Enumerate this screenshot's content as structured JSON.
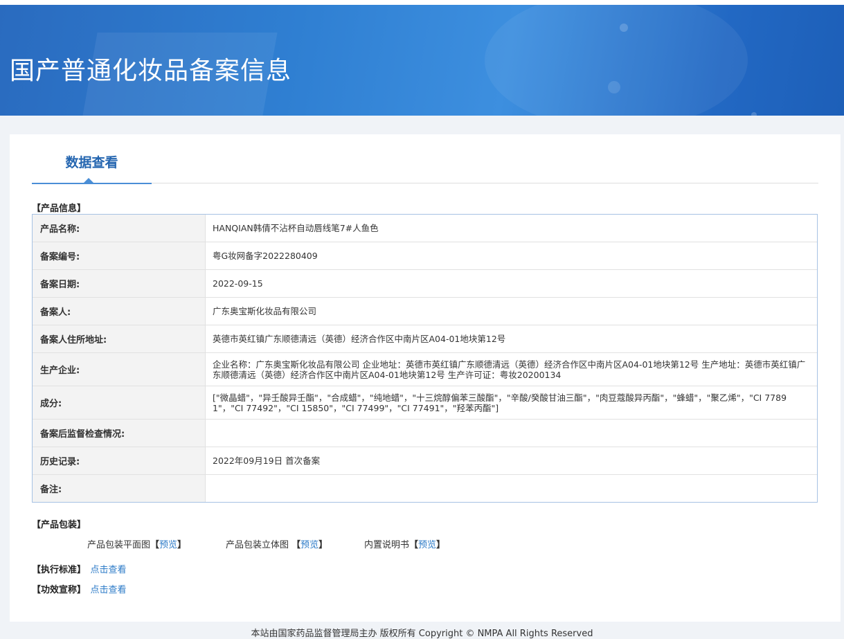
{
  "page": {
    "banner_title": "国产普通化妆品备案信息",
    "tab_label": "数据查看",
    "footer": "本站由国家药品监督管理局主办 版权所有 Copyright © NMPA All Rights Reserved"
  },
  "product_section": {
    "title": "【产品信息】",
    "rows": [
      {
        "label": "产品名称:",
        "value": "HANQIAN韩倩不沾杯自动唇线笔7#人鱼色"
      },
      {
        "label": "备案编号:",
        "value": "粤G妆网备字2022280409"
      },
      {
        "label": "备案日期:",
        "value": "2022-09-15"
      },
      {
        "label": "备案人:",
        "value": "广东奥宝斯化妆品有限公司"
      },
      {
        "label": "备案人住所地址:",
        "value": "英德市英红镇广东顺德清远（英德）经济合作区中南片区A04-01地块第12号"
      },
      {
        "label": "生产企业:",
        "value": "企业名称：广东奥宝斯化妆品有限公司 企业地址：英德市英红镇广东顺德清远（英德）经济合作区中南片区A04-01地块第12号 生产地址：英德市英红镇广东顺德清远（英德）经济合作区中南片区A04-01地块第12号 生产许可证：粤妆20200134"
      },
      {
        "label": "成分:",
        "value": "[\"微晶蜡\"，\"异壬酸异壬酯\"，\"合成蜡\"，\"纯地蜡\"，\"十三烷醇偏苯三酸酯\"，\"辛酸/癸酸甘油三酯\"，\"肉豆蔻酸异丙酯\"，\"蜂蜡\"，\"聚乙烯\"，\"CI 77891\"，\"CI 77492\"，\"CI 15850\"，\"CI 77499\"，\"CI 77491\"，\"羟苯丙酯\"]"
      },
      {
        "label": "备案后监督检查情况:",
        "value": ""
      },
      {
        "label": "历史记录:",
        "value": "2022年09月19日 首次备案"
      },
      {
        "label": "备注:",
        "value": ""
      }
    ]
  },
  "packaging": {
    "title": "【产品包装】",
    "items": [
      {
        "label": "产品包装平面图",
        "open": "【",
        "link": "预览",
        "close": "】"
      },
      {
        "label": "产品包装立体图 ",
        "open": "【",
        "link": "预览",
        "close": "】"
      },
      {
        "label": "内置说明书",
        "open": "【",
        "link": "预览",
        "close": "】"
      }
    ]
  },
  "standard": {
    "title": "【执行标准】",
    "link": "点击查看"
  },
  "efficacy": {
    "title": "【功效宣称】",
    "link": "点击查看"
  },
  "colors": {
    "banner": "#2f7fd2",
    "link": "#2b7ac7",
    "tab": "#2566b0"
  }
}
